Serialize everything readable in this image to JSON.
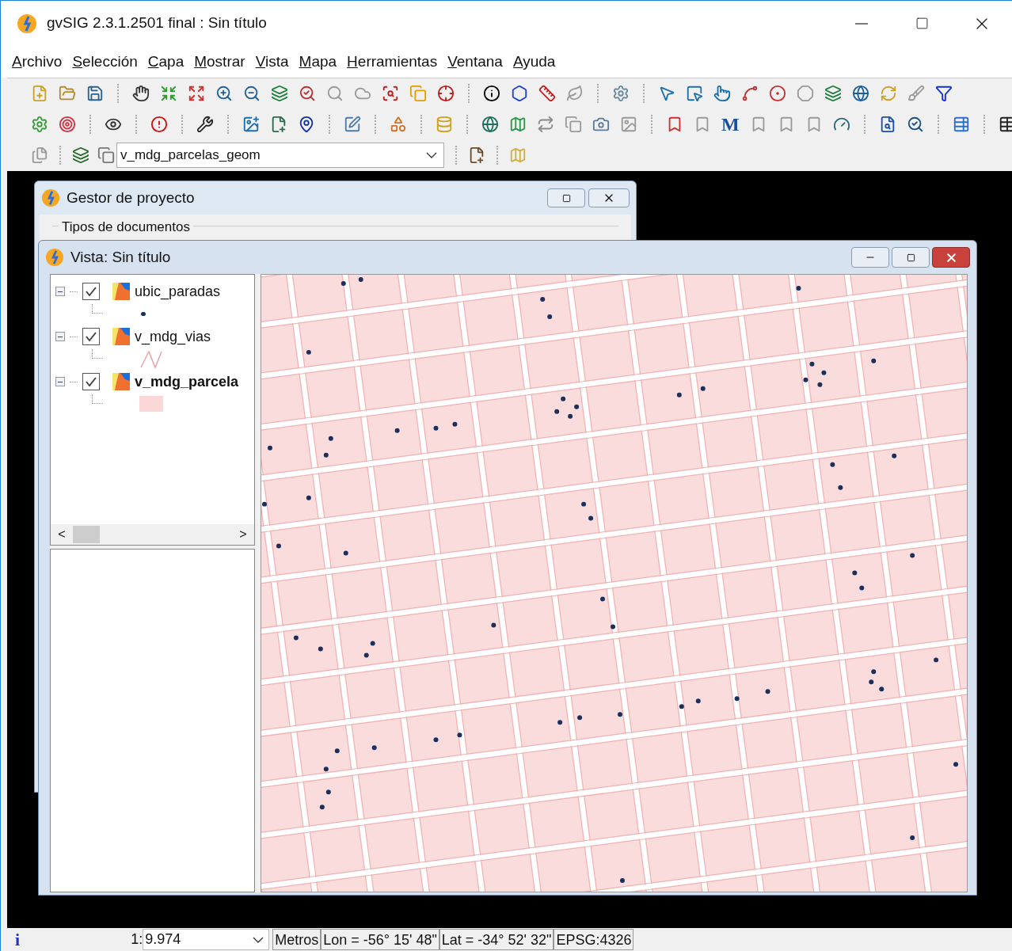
{
  "window": {
    "title": "gvSIG 2.3.1.2501 final : Sin título"
  },
  "menu": [
    "Archivo",
    "Selección",
    "Capa",
    "Mostrar",
    "Vista",
    "Mapa",
    "Herramientas",
    "Ventana",
    "Ayuda"
  ],
  "toolbar": {
    "letter_tool": "M",
    "layer_combo": "v_mdg_parcelas_geom"
  },
  "project_manager": {
    "title": "Gestor de proyecto",
    "group_label": "Tipos de documentos"
  },
  "view_window": {
    "title": "Vista: Sin título",
    "layers": [
      {
        "name": "ubic_paradas",
        "checked": true,
        "expanded": true,
        "active": false,
        "kind": "point"
      },
      {
        "name": "v_mdg_vias",
        "checked": true,
        "expanded": true,
        "active": false,
        "kind": "line"
      },
      {
        "name": "v_mdg_parcela",
        "checked": true,
        "expanded": true,
        "active": true,
        "kind": "polygon"
      }
    ],
    "scroll_left": "<",
    "scroll_right": ">"
  },
  "status_bar": {
    "icon_glyph": "i",
    "scale_prefix": "1:",
    "scale": "9.974",
    "units": "Metros",
    "lon": "Lon = -56° 15' 48\"",
    "lat": "Lat = -34° 52' 32\"",
    "crs": "EPSG:4326"
  }
}
